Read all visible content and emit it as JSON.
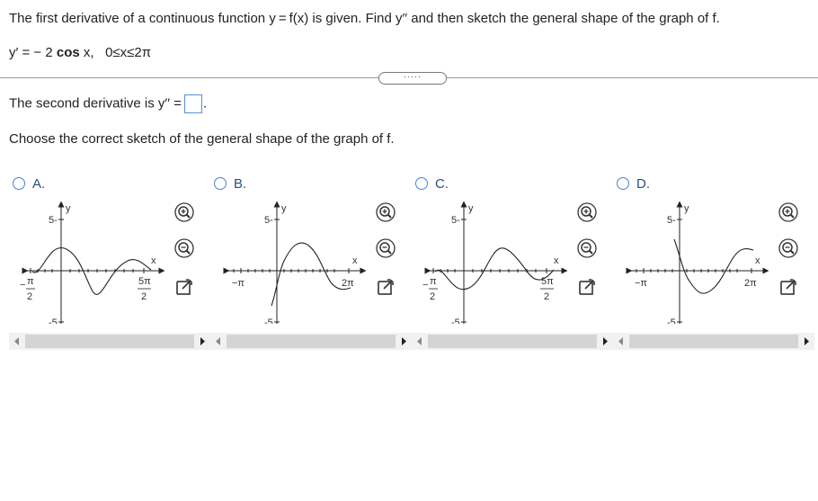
{
  "question": "The first derivative of a continuous function y = f(x) is given. Find y′′ and then sketch the general shape of the graph of f.",
  "derivative": {
    "lhs": "y′ =",
    "minus": "−",
    "coef": "2",
    "func": "cos",
    "var": "x,",
    "domain": "0≤x≤2π"
  },
  "more_button": "·····",
  "second_derivative": {
    "label": "The second derivative is y′′ =",
    "suffix": "."
  },
  "choose_label": "Choose the correct sketch of the general shape of the graph of f.",
  "options": [
    {
      "letter": "A.",
      "x_label": "x",
      "y_label": "y",
      "y_top": "5-",
      "y_bottom": "-5",
      "left_label": "−π/2",
      "right_label": "5π/2"
    },
    {
      "letter": "B.",
      "x_label": "x",
      "y_label": "y",
      "y_top": "5-",
      "y_bottom": "-5",
      "left_label": "−π",
      "right_label": "2π"
    },
    {
      "letter": "C.",
      "x_label": "x",
      "y_label": "y",
      "y_top": "5-",
      "y_bottom": "-5",
      "left_label": "−π/2",
      "right_label": "5π/2"
    },
    {
      "letter": "D.",
      "x_label": "x",
      "y_label": "y",
      "y_top": "5-",
      "y_bottom": "-5",
      "left_label": "−π",
      "right_label": "2π"
    }
  ],
  "colors": {
    "accent": "#4a7fcf",
    "text": "#222222",
    "scroll_track": "#d4d4d4"
  },
  "icons": [
    "zoom-in-icon",
    "zoom-out-icon",
    "open-window-icon",
    "scroll-left-arrow",
    "scroll-right-arrow"
  ]
}
